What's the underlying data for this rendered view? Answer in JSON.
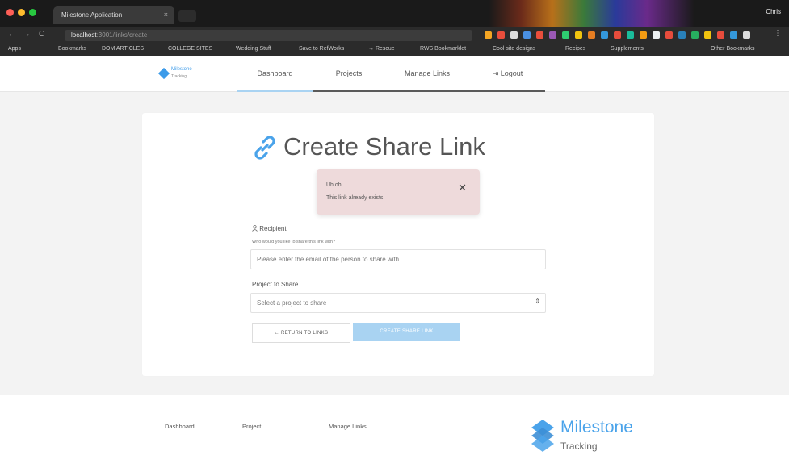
{
  "browser": {
    "tab_title": "Milestone Application",
    "tab_close": "×",
    "profile": "Chris",
    "address_host": "localhost",
    "address_path": ":3001/links/create",
    "back": "←",
    "forward": "→",
    "reload": "C",
    "bookmarks": [
      "Apps",
      "Bookmarks",
      "DOM ARTICLES",
      "COLLEGE SITES",
      "Wedding Stuff",
      "Save to RefWorks",
      "→ Rescue",
      "RWS Bookmarklet",
      "Cool site designs",
      "Recipes",
      "Supplements",
      "Other Bookmarks"
    ]
  },
  "header": {
    "logo_top": "Milestone",
    "logo_bottom": "Tracking",
    "nav": [
      "Dashboard",
      "Projects",
      "Manage Links",
      "Logout"
    ],
    "logout_icon": "⇥"
  },
  "card": {
    "title": "Create Share Link",
    "alert": {
      "heading": "Uh oh...",
      "message": "This link already exists",
      "close": "✕"
    },
    "recipient": {
      "label": "Recipient",
      "hint": "Who would you like to share this link with?",
      "placeholder": "Please enter the email of the person to share with"
    },
    "project": {
      "label": "Project to Share",
      "placeholder": "Select a project to share",
      "arrow": "⇕"
    },
    "buttons": {
      "return": "← RETURN TO LINKS",
      "create": "CREATE SHARE LINK"
    }
  },
  "footer": {
    "links": [
      "Dashboard",
      "Project",
      "Manage Links"
    ],
    "logo_top": "Milestone",
    "logo_bottom": "Tracking"
  },
  "colors": {
    "accent": "#3d9be9",
    "button_primary": "#a9d3f2",
    "alert_bg": "#eedadb"
  }
}
